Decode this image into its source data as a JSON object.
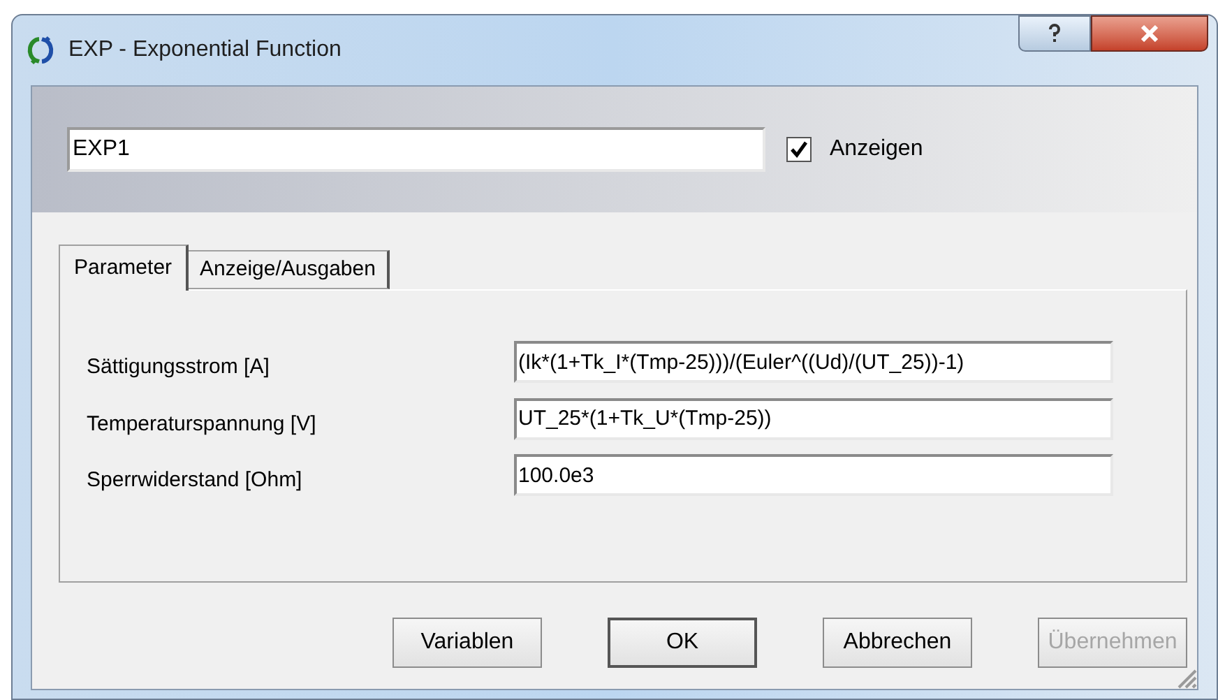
{
  "window": {
    "title": "EXP - Exponential Function"
  },
  "name_field": {
    "value": "EXP1"
  },
  "show_checkbox": {
    "label": "Anzeigen",
    "checked": true
  },
  "tabs": [
    {
      "label": "Parameter",
      "selected": true
    },
    {
      "label": "Anzeige/Ausgaben",
      "selected": false
    }
  ],
  "parameters": [
    {
      "label": "Sättigungsstrom [A]",
      "value": "(Ik*(1+Tk_I*(Tmp-25)))/(Euler^((Ud)/(UT_25))-1)"
    },
    {
      "label": "Temperaturspannung [V]",
      "value": "UT_25*(1+Tk_U*(Tmp-25))"
    },
    {
      "label": "Sperrwiderstand [Ohm]",
      "value": "100.0e3"
    }
  ],
  "buttons": [
    {
      "label": "Variablen",
      "default": false,
      "disabled": false
    },
    {
      "label": "OK",
      "default": true,
      "disabled": false
    },
    {
      "label": "Abbrechen",
      "default": false,
      "disabled": false
    },
    {
      "label": "Übernehmen",
      "default": false,
      "disabled": true
    }
  ]
}
